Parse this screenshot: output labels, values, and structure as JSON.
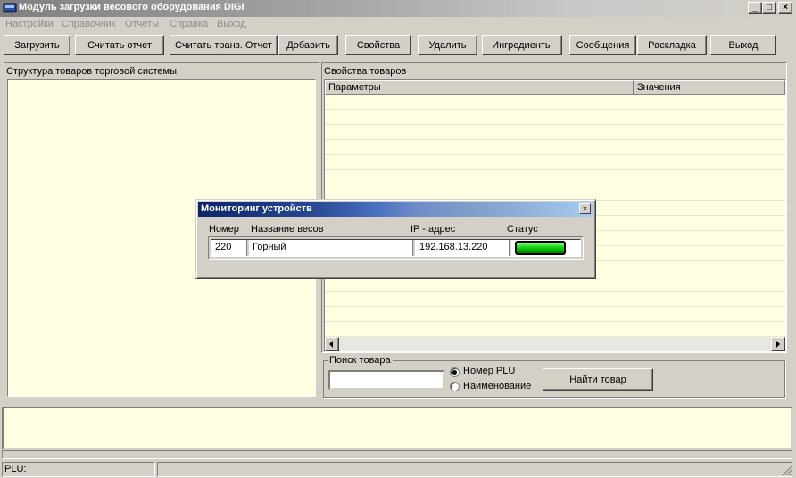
{
  "window": {
    "title": "Модуль загрузки весового оборудования DIGI",
    "minimize": "_",
    "maximize": "□",
    "close": "×"
  },
  "menu": {
    "items": [
      "Настройки",
      "Справочник",
      "Отчеты",
      "Справка",
      "Выход"
    ]
  },
  "toolbar": {
    "buttons": [
      "Загрузить",
      "Считать отчет",
      "Считать транз. Отчет",
      "Добавить",
      "Свойства",
      "Удалить",
      "Ингредиенты",
      "Сообщения",
      "Раскладка",
      "Выход"
    ]
  },
  "left_panel": {
    "title": "Структура товаров торговой системы"
  },
  "right_panel": {
    "title": "Свойства товаров",
    "columns": [
      "Параметры",
      "Значения"
    ]
  },
  "search": {
    "group_title": "Поиск товара",
    "input_value": "",
    "radio_plu": "Номер PLU",
    "radio_name": "Наименование",
    "selected": "Номер PLU",
    "find_button": "Найти товар"
  },
  "status_bar": {
    "plu_label": "PLU:"
  },
  "dialog": {
    "title": "Мониторинг устройств",
    "close": "×",
    "columns": [
      "Номер",
      "Название весов",
      "IP - адрес",
      "Статус"
    ],
    "rows": [
      {
        "number": "220",
        "name": "Горный",
        "ip": "192.168.13.220",
        "status": "online"
      }
    ],
    "status_color": "#00c000"
  },
  "colors": {
    "panel_bg": "#ffffe1",
    "chrome": "#d4d0c8",
    "dialog_title": "#0a246a"
  }
}
